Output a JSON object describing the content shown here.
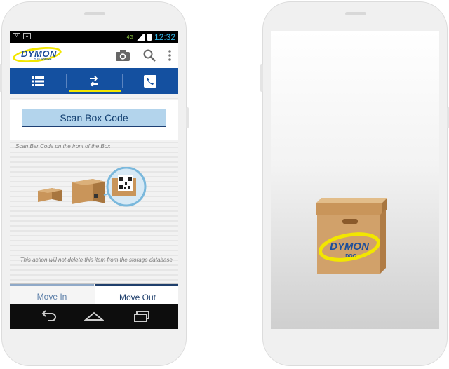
{
  "statusbar": {
    "time": "12:32",
    "network": "4G"
  },
  "tabs": [
    {
      "name": "list",
      "icon": "list-icon"
    },
    {
      "name": "transfer",
      "icon": "transfer-arrows-icon",
      "selected": true
    },
    {
      "name": "contact",
      "icon": "phone-icon"
    }
  ],
  "logo": {
    "main": "DYMON",
    "sub": "STORAGE"
  },
  "appbar": {
    "icons": [
      "camera-icon",
      "search-icon",
      "overflow-menu-icon"
    ]
  },
  "scan": {
    "button_label": "Scan Box Code",
    "hint": "Scan Bar Code on the front of the Box",
    "note": "This action will not delete this item from the storage database."
  },
  "bottom_tabs": {
    "move_in": "Move In",
    "move_out": "Move Out",
    "selected": "move_out"
  },
  "app_icon": {
    "main": "DYMON",
    "sub": "DOC"
  },
  "colors": {
    "brand_blue": "#1450a0",
    "accent_yellow": "#f2e600",
    "button_bg": "#b3d4ec"
  }
}
